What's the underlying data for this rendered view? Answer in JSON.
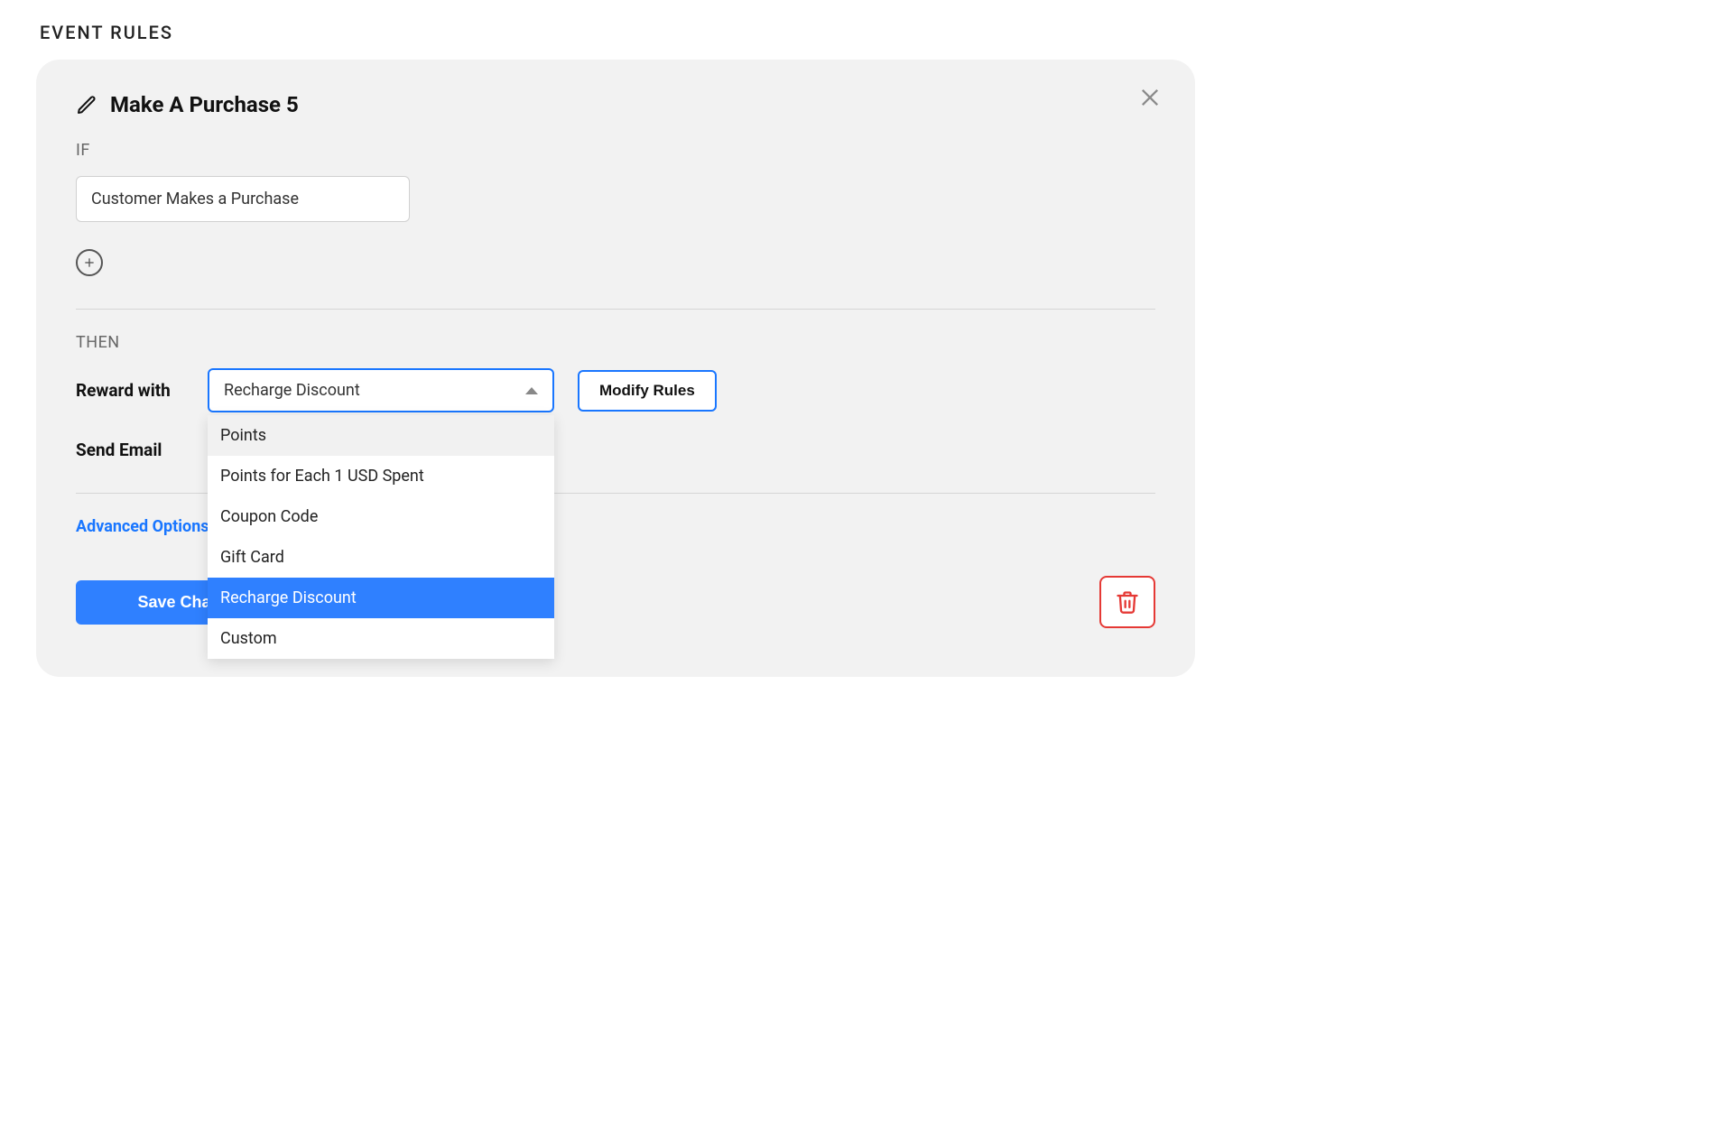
{
  "section_heading": "EVENT RULES",
  "rule": {
    "title": "Make A Purchase 5",
    "if_label": "IF",
    "condition": "Customer Makes a Purchase",
    "then_label": "THEN",
    "reward_label": "Reward with",
    "reward_selected": "Recharge Discount",
    "reward_options": [
      {
        "label": "Points",
        "state": "hover"
      },
      {
        "label": "Points for Each 1 USD Spent",
        "state": ""
      },
      {
        "label": "Coupon Code",
        "state": ""
      },
      {
        "label": "Gift Card",
        "state": ""
      },
      {
        "label": "Recharge Discount",
        "state": "selected"
      },
      {
        "label": "Custom",
        "state": ""
      }
    ],
    "modify_rules_label": "Modify Rules",
    "send_email_label": "Send Email",
    "advanced_options_label": "Advanced Options",
    "save_label": "Save Changes"
  }
}
